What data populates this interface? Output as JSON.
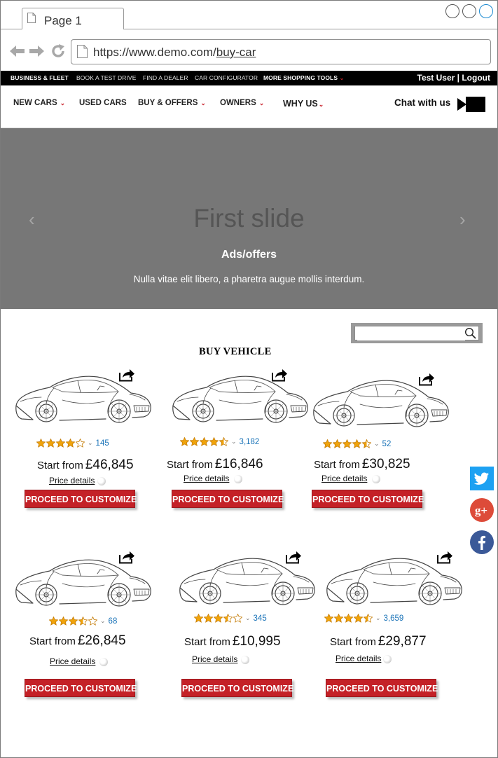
{
  "browser": {
    "tab_title": "Page 1",
    "url_prefix": "https://www.demo.com/",
    "url_path": "buy-car"
  },
  "utility_bar": {
    "items": [
      {
        "label": "BUSINESS & FLEET"
      },
      {
        "label": "BOOK A TEST DRIVE"
      },
      {
        "label": "FIND A DEALER"
      },
      {
        "label": "CAR CONFIGURATOR"
      },
      {
        "label": "MORE SHOPPING TOOLS"
      }
    ],
    "user_text": "Test User | Logout"
  },
  "main_nav": {
    "items": [
      {
        "label": "NEW CARS"
      },
      {
        "label": "USED CARS"
      },
      {
        "label": "BUY & OFFERS"
      },
      {
        "label": "OWNERS"
      },
      {
        "label": "WHY US"
      }
    ],
    "chat_label": "Chat with us"
  },
  "carousel": {
    "title": "First slide",
    "caption": "Ads/offers",
    "text": "Nulla vitae elit libero, a pharetra augue mollis interdum."
  },
  "search": {
    "placeholder": "",
    "value": ""
  },
  "section_title": "BUY VEHICLE",
  "products": [
    {
      "rating": 4.0,
      "count": "145",
      "start_label": "Start from",
      "price": "£46,845",
      "details_label": "Price details",
      "cta": "PROCEED TO CUSTOMIZE"
    },
    {
      "rating": 4.5,
      "count": "3,182",
      "start_label": "Start from",
      "price": "£16,846",
      "details_label": "Price details",
      "cta": "PROCEED TO CUSTOMIZE"
    },
    {
      "rating": 4.5,
      "count": "52",
      "start_label": "Start from",
      "price": "£30,825",
      "details_label": "Price details",
      "cta": "PROCEED TO CUSTOMIZE"
    },
    {
      "rating": 3.5,
      "count": "68",
      "start_label": "Start from",
      "price": "£26,845",
      "details_label": "Price details",
      "cta": "PROCEED TO CUSTOMIZE"
    },
    {
      "rating": 3.5,
      "count": "345",
      "start_label": "Start from",
      "price": "£10,995",
      "details_label": "Price details",
      "cta": "PROCEED TO CUSTOMIZE"
    },
    {
      "rating": 4.5,
      "count": "3,659",
      "start_label": "Start from",
      "price": "£29,877",
      "details_label": "Price details",
      "cta": "PROCEED TO CUSTOMIZE"
    }
  ],
  "social": [
    {
      "name": "twitter",
      "icon": "twitter-icon",
      "color": "#1da1f2"
    },
    {
      "name": "google-plus",
      "icon": "google-plus-icon",
      "color": "#dd4b39"
    },
    {
      "name": "facebook",
      "icon": "facebook-icon",
      "color": "#3b5998"
    }
  ],
  "colors": {
    "accent_red": "#c42127",
    "carousel_bg": "#777777",
    "star_gold": "#f0a30a",
    "link_blue": "#1a73b8"
  }
}
